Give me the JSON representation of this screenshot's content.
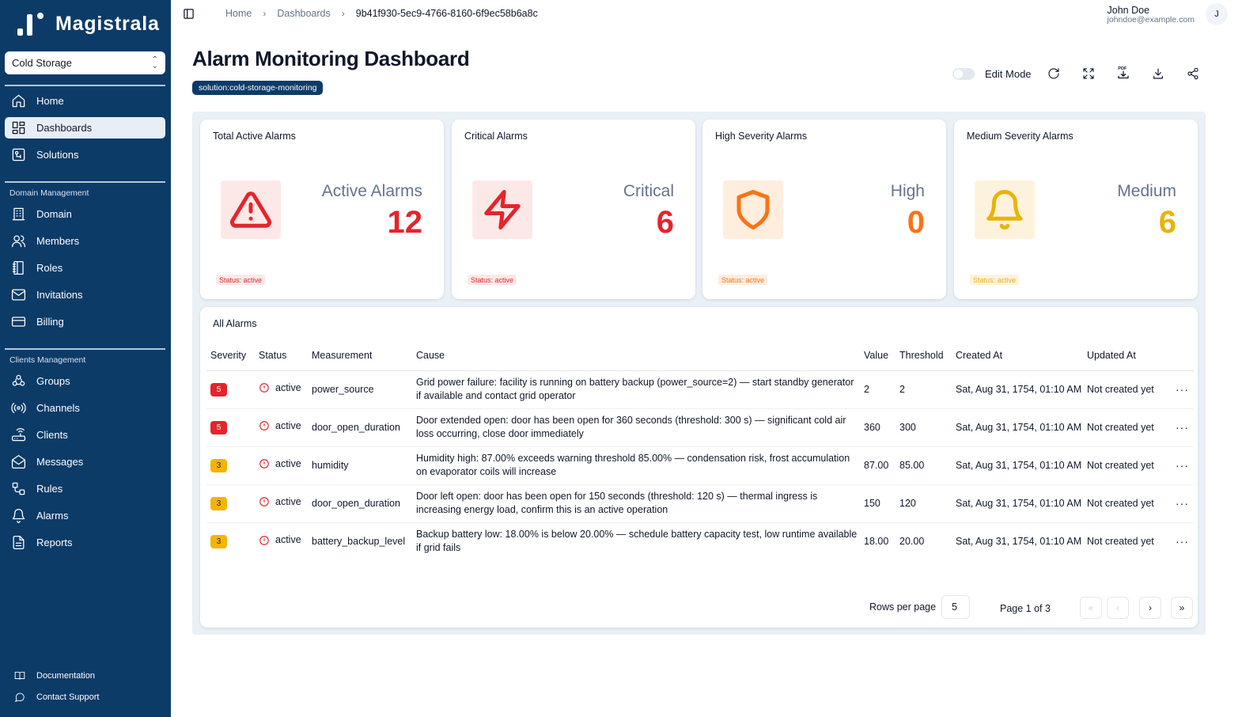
{
  "app": {
    "name": "Magistrala"
  },
  "workspace": {
    "selected": "Cold Storage"
  },
  "nav": {
    "primary": [
      {
        "label": "Home",
        "icon": "home-icon"
      },
      {
        "label": "Dashboards",
        "icon": "dashboard-icon",
        "active": true
      },
      {
        "label": "Solutions",
        "icon": "solutions-icon"
      }
    ],
    "domain_section": "Domain Management",
    "domain": [
      {
        "label": "Domain",
        "icon": "building-icon"
      },
      {
        "label": "Members",
        "icon": "users-icon"
      },
      {
        "label": "Roles",
        "icon": "notebook-icon"
      },
      {
        "label": "Invitations",
        "icon": "mail-icon"
      },
      {
        "label": "Billing",
        "icon": "credit-card-icon"
      }
    ],
    "clients_section": "Clients Management",
    "clients": [
      {
        "label": "Groups",
        "icon": "groups-icon"
      },
      {
        "label": "Channels",
        "icon": "radio-icon"
      },
      {
        "label": "Clients",
        "icon": "router-icon"
      },
      {
        "label": "Messages",
        "icon": "mail-open-icon"
      },
      {
        "label": "Rules",
        "icon": "rules-icon"
      },
      {
        "label": "Alarms",
        "icon": "bell-icon"
      },
      {
        "label": "Reports",
        "icon": "report-icon"
      }
    ],
    "footer": [
      {
        "label": "Documentation",
        "icon": "book-icon"
      },
      {
        "label": "Contact Support",
        "icon": "chat-icon"
      }
    ]
  },
  "breadcrumb": [
    "Home",
    "Dashboards",
    "9b41f930-5ec9-4766-8160-6f9ec58b6a8c"
  ],
  "user": {
    "name": "John Doe",
    "email": "johndoe@example.com",
    "initial": "J"
  },
  "page": {
    "title": "Alarm Monitoring Dashboard",
    "tag": "solution:cold-storage-monitoring"
  },
  "toolbar": {
    "edit_mode_label": "Edit Mode",
    "edit_mode_on": false,
    "pdf_label": "PDF"
  },
  "cards": [
    {
      "title": "Total Active Alarms",
      "label": "Active Alarms",
      "value": "12",
      "status": "Status: active",
      "color": "#e5242b",
      "bg": "#fde8e8",
      "icon": "warning-icon"
    },
    {
      "title": "Critical Alarms",
      "label": "Critical",
      "value": "6",
      "status": "Status: active",
      "color": "#e5242b",
      "bg": "#fde8e8",
      "icon": "lightning-icon"
    },
    {
      "title": "High Severity Alarms",
      "label": "High",
      "value": "0",
      "status": "Status: active",
      "color": "#f97316",
      "bg": "#ffedde",
      "icon": "shield-icon"
    },
    {
      "title": "Medium Severity Alarms",
      "label": "Medium",
      "value": "6",
      "status": "Status: active",
      "color": "#eab308",
      "bg": "#fdf3dc",
      "icon": "bell-icon"
    }
  ],
  "table": {
    "title": "All Alarms",
    "columns": [
      "Severity",
      "Status",
      "Measurement",
      "Cause",
      "Value",
      "Threshold",
      "Created At",
      "Updated At"
    ],
    "rows": [
      {
        "severity": "5",
        "status": "active",
        "measurement": "power_source",
        "cause": "Grid power failure: facility is running on battery backup (power_source=2) — start standby generator if available and contact grid operator",
        "value": "2",
        "threshold": "2",
        "created": "Sat, Aug 31, 1754, 01:10 AM",
        "updated": "Not created yet"
      },
      {
        "severity": "5",
        "status": "active",
        "measurement": "door_open_duration",
        "cause": "Door extended open: door has been open for 360 seconds (threshold: 300 s) — significant cold air loss occurring, close door immediately",
        "value": "360",
        "threshold": "300",
        "created": "Sat, Aug 31, 1754, 01:10 AM",
        "updated": "Not created yet"
      },
      {
        "severity": "3",
        "status": "active",
        "measurement": "humidity",
        "cause": "Humidity high: 87.00% exceeds warning threshold 85.00% — condensation risk, frost accumulation on evaporator coils will increase",
        "value": "87.00",
        "threshold": "85.00",
        "created": "Sat, Aug 31, 1754, 01:10 AM",
        "updated": "Not created yet"
      },
      {
        "severity": "3",
        "status": "active",
        "measurement": "door_open_duration",
        "cause": "Door left open: door has been open for 150 seconds (threshold: 120 s) — thermal ingress is increasing energy load, confirm this is an active operation",
        "value": "150",
        "threshold": "120",
        "created": "Sat, Aug 31, 1754, 01:10 AM",
        "updated": "Not created yet"
      },
      {
        "severity": "3",
        "status": "active",
        "measurement": "battery_backup_level",
        "cause": "Backup battery low: 18.00% is below 20.00% — schedule battery capacity test, low runtime available if grid fails",
        "value": "18.00",
        "threshold": "20.00",
        "created": "Sat, Aug 31, 1754, 01:10 AM",
        "updated": "Not created yet"
      }
    ],
    "rows_per_page_label": "Rows per page",
    "rows_per_page": "5",
    "page_info": "Page 1 of 3",
    "first_label": "«",
    "prev_label": "‹",
    "next_label": "›",
    "last_label": "»"
  }
}
